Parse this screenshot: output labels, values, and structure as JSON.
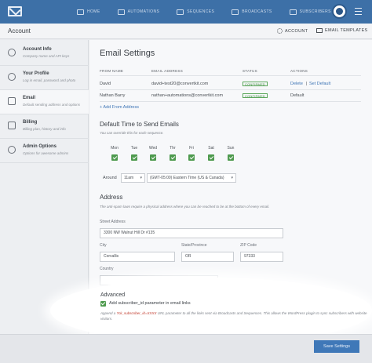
{
  "nav": {
    "items": [
      {
        "label": "Home",
        "icon": "home-icon"
      },
      {
        "label": "Automations",
        "icon": "automation-icon"
      },
      {
        "label": "Sequences",
        "icon": "sequence-icon"
      },
      {
        "label": "Broadcasts",
        "icon": "broadcast-icon"
      },
      {
        "label": "Subscribers",
        "icon": "subscribers-icon"
      }
    ],
    "accent": "#3d70a7"
  },
  "header": {
    "title": "Account",
    "account_link": "Account",
    "templates_link": "Email Templates"
  },
  "sidebar": {
    "items": [
      {
        "title": "Account Info",
        "subtitle": "Company name and API keys",
        "icon": "gear-icon"
      },
      {
        "title": "Your Profile",
        "subtitle": "Log in email, password and photo",
        "icon": "user-icon"
      },
      {
        "title": "Email",
        "subtitle": "Default sending address and options",
        "icon": "envelope-icon",
        "active": true
      },
      {
        "title": "Billing",
        "subtitle": "Billing plan, history and info",
        "icon": "credit-card-icon"
      },
      {
        "title": "Admin Options",
        "subtitle": "Options for awesome admins",
        "icon": "admin-icon"
      }
    ]
  },
  "main": {
    "title": "Email Settings",
    "table": {
      "headers": [
        "From Name",
        "Email Address",
        "Status",
        "Actions"
      ],
      "rows": [
        {
          "name": "David",
          "email": "david+test20@convertkit.com",
          "status": "Confirmed",
          "actions": [
            "Delete",
            "Set Default"
          ]
        },
        {
          "name": "Nathan Barry",
          "email": "nathan+automations@convertkit.com",
          "status": "Confirmed",
          "actions": [
            "Default"
          ]
        }
      ],
      "add_link": "+ Add From Address"
    },
    "default_time": {
      "title": "Default Time to Send Emails",
      "hint": "You can override this for each sequence.",
      "days": [
        "Mon",
        "Tue",
        "Wed",
        "Thr",
        "Fri",
        "Sat",
        "Sun"
      ],
      "around_label": "Around",
      "time": "11am",
      "timezone": "(GMT-05:00) Eastern Time (US & Canada)"
    },
    "address": {
      "title": "Address",
      "hint": "The anti-spam laws require a physical address where you can be reached to be at the bottom of every email.",
      "street_label": "Street Address",
      "street_value": "3300 NW Walnut Hill Dr #135",
      "city_label": "City",
      "city_value": "Corvallis",
      "state_label": "State/Province",
      "state_value": "OR",
      "zip_label": "ZIP Code",
      "zip_value": "97333",
      "country_label": "Country",
      "country_value": ""
    },
    "advanced": {
      "title": "Advanced",
      "checkbox_label": "Add subscriber_id parameter in email links",
      "desc_pre": "Append a",
      "desc_code": "?ck_subscriber_id=XXXX",
      "desc_post": "URL parameter to all the links sent via Broadcasts and Sequences. This allows the WordPress plugin to sync subscribers with website visitors."
    },
    "save_label": "Save Settings"
  }
}
